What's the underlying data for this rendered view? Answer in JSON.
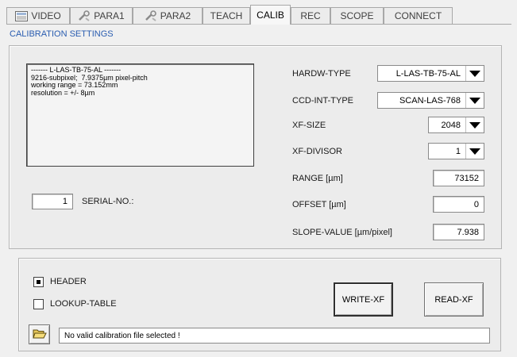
{
  "tabs": [
    {
      "label": "VIDEO",
      "icon": "video-icon"
    },
    {
      "label": "PARA1",
      "icon": "wrench-icon"
    },
    {
      "label": "PARA2",
      "icon": "wrench-icon"
    },
    {
      "label": "TEACH",
      "icon": ""
    },
    {
      "label": "CALIB",
      "icon": ""
    },
    {
      "label": "REC",
      "icon": ""
    },
    {
      "label": "SCOPE",
      "icon": ""
    },
    {
      "label": "CONNECT",
      "icon": ""
    }
  ],
  "active_tab": "CALIB",
  "section_title": "CALIBRATION SETTINGS",
  "info_text": {
    "line1": "------- L-LAS-TB-75-AL -------",
    "line2": "9216-subpixel;  7.9375µm pixel-pitch",
    "line3": "working range = 73.152mm",
    "line4": "resolution = +/- 8µm"
  },
  "serial": {
    "value": "1",
    "label": "SERIAL-NO.:"
  },
  "settings": {
    "hardw_type": {
      "label": "HARDW-TYPE",
      "value": "L-LAS-TB-75-AL"
    },
    "ccd_int_type": {
      "label": "CCD-INT-TYPE",
      "value": "SCAN-LAS-768"
    },
    "xf_size": {
      "label": "XF-SIZE",
      "value": "2048"
    },
    "xf_divisor": {
      "label": "XF-DIVISOR",
      "value": "1"
    },
    "range": {
      "label": "RANGE  [µm]",
      "value": "73152"
    },
    "offset": {
      "label": "OFFSET  [µm]",
      "value": "0"
    },
    "slope": {
      "label": "SLOPE-VALUE [µm/pixel]",
      "value": "7.938"
    }
  },
  "checkboxes": {
    "header": {
      "label": "HEADER",
      "checked": true
    },
    "lookup": {
      "label": "LOOKUP-TABLE",
      "checked": false
    }
  },
  "buttons": {
    "write": "WRITE-XF",
    "read": "READ-XF"
  },
  "status_text": "No valid calibration file selected !",
  "colors": {
    "accent": "#2a5db0"
  }
}
